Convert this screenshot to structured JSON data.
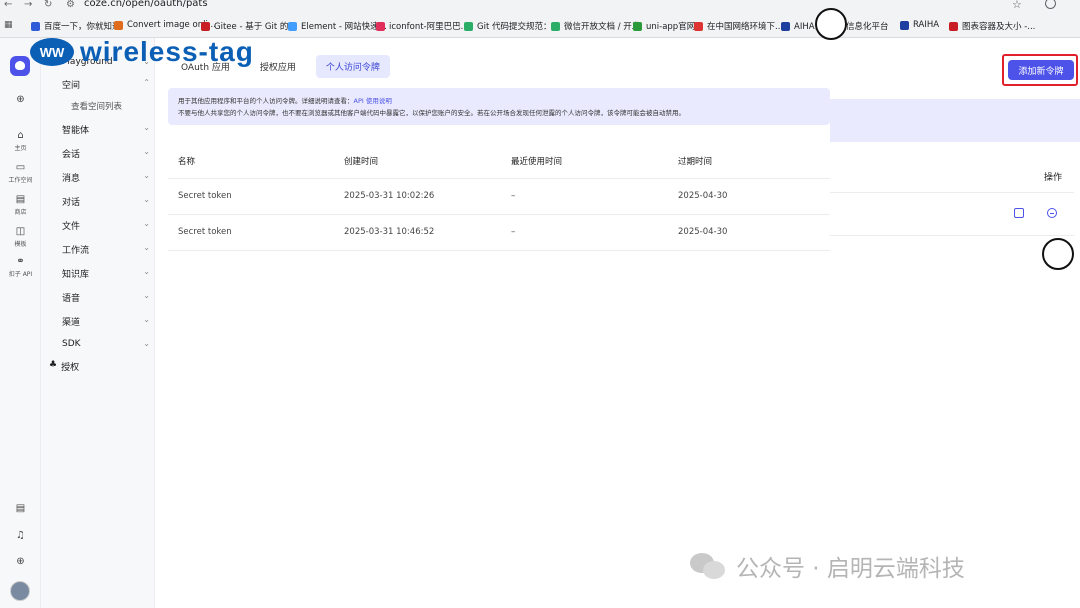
{
  "browser": {
    "url": "coze.cn/open/oauth/pats",
    "bookmarks": [
      {
        "label": "百度一下，你就知道",
        "color": "#2f5bd8"
      },
      {
        "label": "Convert image onli...",
        "color": "#e06b1f"
      },
      {
        "label": "Gitee - 基于 Git 的...",
        "color": "#c71d23"
      },
      {
        "label": "Element - 网站快速...",
        "color": "#409eff"
      },
      {
        "label": "iconfont-阿里巴巴...",
        "color": "#e02f5b"
      },
      {
        "label": "Git 代码提交规范：...",
        "color": "#2aae67"
      },
      {
        "label": "微信开放文档 / 开发",
        "color": "#2aae67"
      },
      {
        "label": "uni-app官网",
        "color": "#2b9939"
      },
      {
        "label": "在中国网络环境下...",
        "color": "#d33"
      },
      {
        "label": "AIHA云",
        "color": "#1d3fa0"
      },
      {
        "label": "信息化平台",
        "color": "#1d3fa0"
      },
      {
        "label": "RAIHA",
        "color": "#1d3fa0"
      },
      {
        "label": "图表容器及大小 -...",
        "color": "#c71d23"
      }
    ]
  },
  "overlay_logo": {
    "mark": "WW",
    "text": "wireless-tag"
  },
  "rail": {
    "items": [
      {
        "label": "主页",
        "icon": "home-icon"
      },
      {
        "label": "工作空间",
        "icon": "workspace-icon"
      },
      {
        "label": "商店",
        "icon": "store-icon"
      },
      {
        "label": "模板",
        "icon": "template-icon"
      },
      {
        "label": "扣子 API",
        "icon": "api-icon"
      }
    ]
  },
  "sidebar": {
    "items": [
      {
        "label": "Playground",
        "chevron": "⌄"
      },
      {
        "label": "空间",
        "chevron": "⌃"
      },
      {
        "label": "智能体",
        "chevron": "⌄"
      },
      {
        "label": "会话",
        "chevron": "⌄"
      },
      {
        "label": "消息",
        "chevron": "⌄"
      },
      {
        "label": "对话",
        "chevron": "⌄"
      },
      {
        "label": "文件",
        "chevron": "⌄"
      },
      {
        "label": "工作流",
        "chevron": "⌄"
      },
      {
        "label": "知识库",
        "chevron": "⌄"
      },
      {
        "label": "语音",
        "chevron": "⌄"
      },
      {
        "label": "渠道",
        "chevron": "⌄"
      },
      {
        "label": "SDK",
        "chevron": "⌄"
      }
    ],
    "sub_item": "查看空间列表",
    "auth": "授权"
  },
  "tabs": [
    "OAuth 应用",
    "授权应用",
    "个人访问令牌"
  ],
  "notice": {
    "line1": "用于其他应用程序和平台的个人访问令牌。详细说明请查看：",
    "link": "API 使用说明",
    "line2": "不要与他人共享您的个人访问令牌，也不要在浏览器或其他客户端代码中暴露它，以保护您账户的安全。若在公开场合发现任何泄露的个人访问令牌，该令牌可能会被自动禁用。"
  },
  "table": {
    "headers": [
      "名称",
      "创建时间",
      "最近使用时间",
      "过期时间"
    ],
    "rows": [
      [
        "Secret token",
        "2025-03-31 10:02:26",
        "–",
        "2025-04-30"
      ],
      [
        "Secret token",
        "2025-03-31 10:46:52",
        "–",
        "2025-04-30"
      ]
    ],
    "action_header": "操作"
  },
  "add_button": "添加新令牌",
  "watermark": "公众号 · 启明云端科技"
}
